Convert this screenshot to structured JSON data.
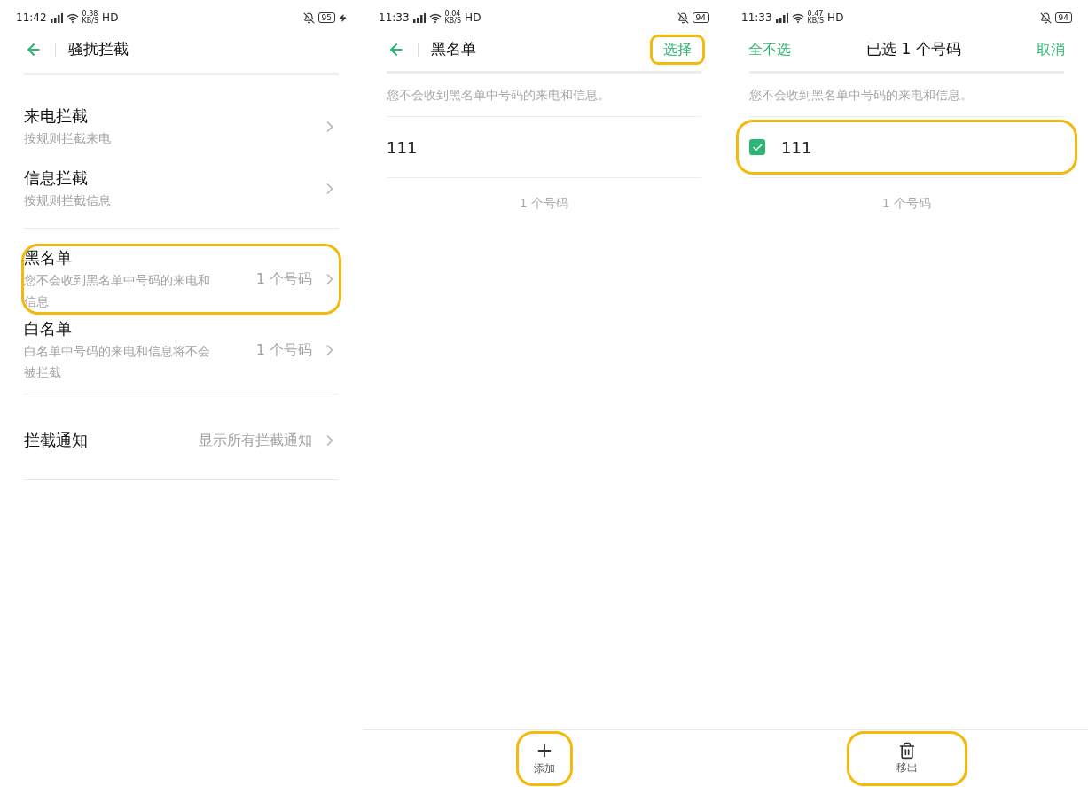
{
  "screens": [
    {
      "kind": "menu",
      "status_bar": {
        "time": "11:42",
        "speed": "0.38",
        "speed_unit": "KB/S",
        "network": "HD",
        "battery": "95",
        "charging": true
      },
      "header": {
        "title": "骚扰拦截"
      },
      "groups": [
        [
          {
            "title": "来电拦截",
            "subtitle": "按规则拦截来电",
            "highlighted": false
          },
          {
            "title": "信息拦截",
            "subtitle": "按规则拦截信息",
            "highlighted": false
          }
        ],
        [
          {
            "title": "黑名单",
            "subtitle": "您不会收到黑名单中号码的来电和信息",
            "value": "1 个号码",
            "highlighted": true
          },
          {
            "title": "白名单",
            "subtitle": "白名单中号码的来电和信息将不会被拦截",
            "value": "1 个号码",
            "highlighted": false
          }
        ],
        [
          {
            "title": "拦截通知",
            "value": "显示所有拦截通知",
            "highlighted": false
          }
        ]
      ]
    },
    {
      "kind": "list",
      "status_bar": {
        "time": "11:33",
        "speed": "0.04",
        "speed_unit": "KB/S",
        "network": "HD",
        "battery": "94"
      },
      "header": {
        "title": "黑名单",
        "action": {
          "label": "选择",
          "highlighted": true
        }
      },
      "hint": "您不会收到黑名单中号码的来电和信息。",
      "entries": [
        {
          "number": "111",
          "highlighted": false
        }
      ],
      "count": "1 个号码",
      "bottom_action": {
        "kind": "add",
        "label": "添加",
        "highlighted": true
      }
    },
    {
      "kind": "select",
      "status_bar": {
        "time": "11:33",
        "speed": "0.47",
        "speed_unit": "KB/S",
        "network": "HD",
        "battery": "94"
      },
      "header": {
        "left": "全不选",
        "title": "已选 1 个号码",
        "right": "取消"
      },
      "hint": "您不会收到黑名单中号码的来电和信息。",
      "entries": [
        {
          "number": "111",
          "checked": true,
          "highlighted": true
        }
      ],
      "count": "1 个号码",
      "bottom_action": {
        "kind": "remove",
        "label": "移出",
        "highlighted": true
      }
    }
  ]
}
